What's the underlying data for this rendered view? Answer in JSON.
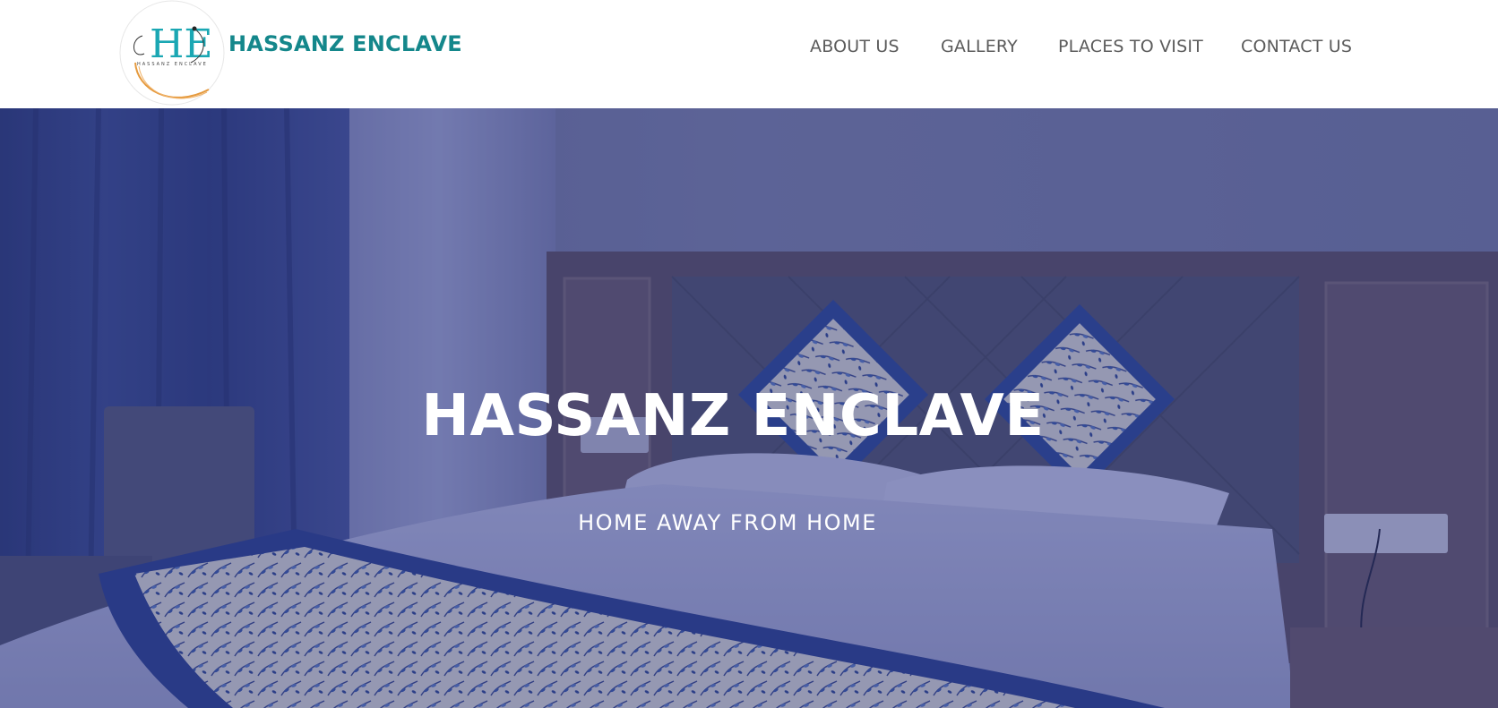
{
  "header": {
    "logo_letters": "HE",
    "logo_ring_text": "HASSANZ ENCLAVE",
    "brand_name": "HASSANZ ENCLAVE",
    "brand_color": "#14878b",
    "nav": [
      {
        "label": "ABOUT US"
      },
      {
        "label": "GALLERY"
      },
      {
        "label": "PLACES TO VISIT"
      },
      {
        "label": "CONTACT US"
      }
    ]
  },
  "hero": {
    "title": "HASSANZ ENCLAVE",
    "subtitle": "HOME AWAY FROM HOME",
    "background_image": "hotel room with bed, blue patterned cushions and runner, wooden headboard, blue curtains",
    "overlay_color": "#28327a"
  }
}
